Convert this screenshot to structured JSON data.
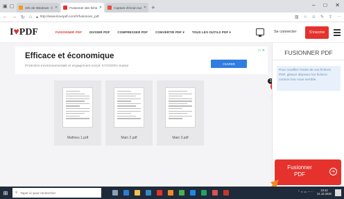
{
  "browser": {
    "tabs": [
      {
        "label": "Info de Windows - bara",
        "icon_color": "#f39c12",
        "active": false
      },
      {
        "label": "Fusionner des fichiers P",
        "icon_color": "#e5322d",
        "active": true
      },
      {
        "label": "Capture d'écran sur PC avec",
        "icon_color": "#e74c3c",
        "active": false
      }
    ],
    "url": "http://www.ilovepdf.com/fr/fusionner_pdf",
    "window_controls": [
      "–",
      "□",
      "✕"
    ]
  },
  "header": {
    "logo_pre": "I",
    "logo_heart": "♥",
    "logo_post": "PDF",
    "nav": [
      {
        "label": "FUSIONNER PDF",
        "active": true
      },
      {
        "label": "DIVISER PDF",
        "active": false
      },
      {
        "label": "COMPRESSER PDF",
        "active": false
      },
      {
        "label": "CONVERTIR PDF ▾",
        "active": false
      },
      {
        "label": "TOUS LES OUTILS PDF ▾",
        "active": false
      }
    ],
    "login": "Se connecter",
    "signup": "S'inscrire"
  },
  "ad": {
    "title": "Efficace et économique",
    "subtitle": "Protection environnementale et engagement social: KYOCERA Suisse",
    "button": "OUVRIR",
    "adchoices": "▷ ✕"
  },
  "files": [
    {
      "name": "Mathieu 1.pdf"
    },
    {
      "name": "Main 2.pdf"
    },
    {
      "name": "Main 3.pdf"
    }
  ],
  "file_count_badge": "3",
  "add_symbol": "+",
  "sort_symbol": "⇅",
  "sidebar": {
    "title": "FUSIONNER PDF",
    "info": "Pour modifier l'ordre de vos fichiers PDF, glissez déposez les fichiers comme bon vous semble.",
    "merge_button": "Fusionner PDF",
    "merge_arrow": "➔"
  },
  "taskbar": {
    "search_placeholder": "Taper ici pour rechercher",
    "time": "10:42",
    "date": "31.10.2020"
  },
  "colors": {
    "brand": "#e5322d",
    "ad_button": "#2f7de1",
    "taskbar": "#1f2b3a"
  }
}
